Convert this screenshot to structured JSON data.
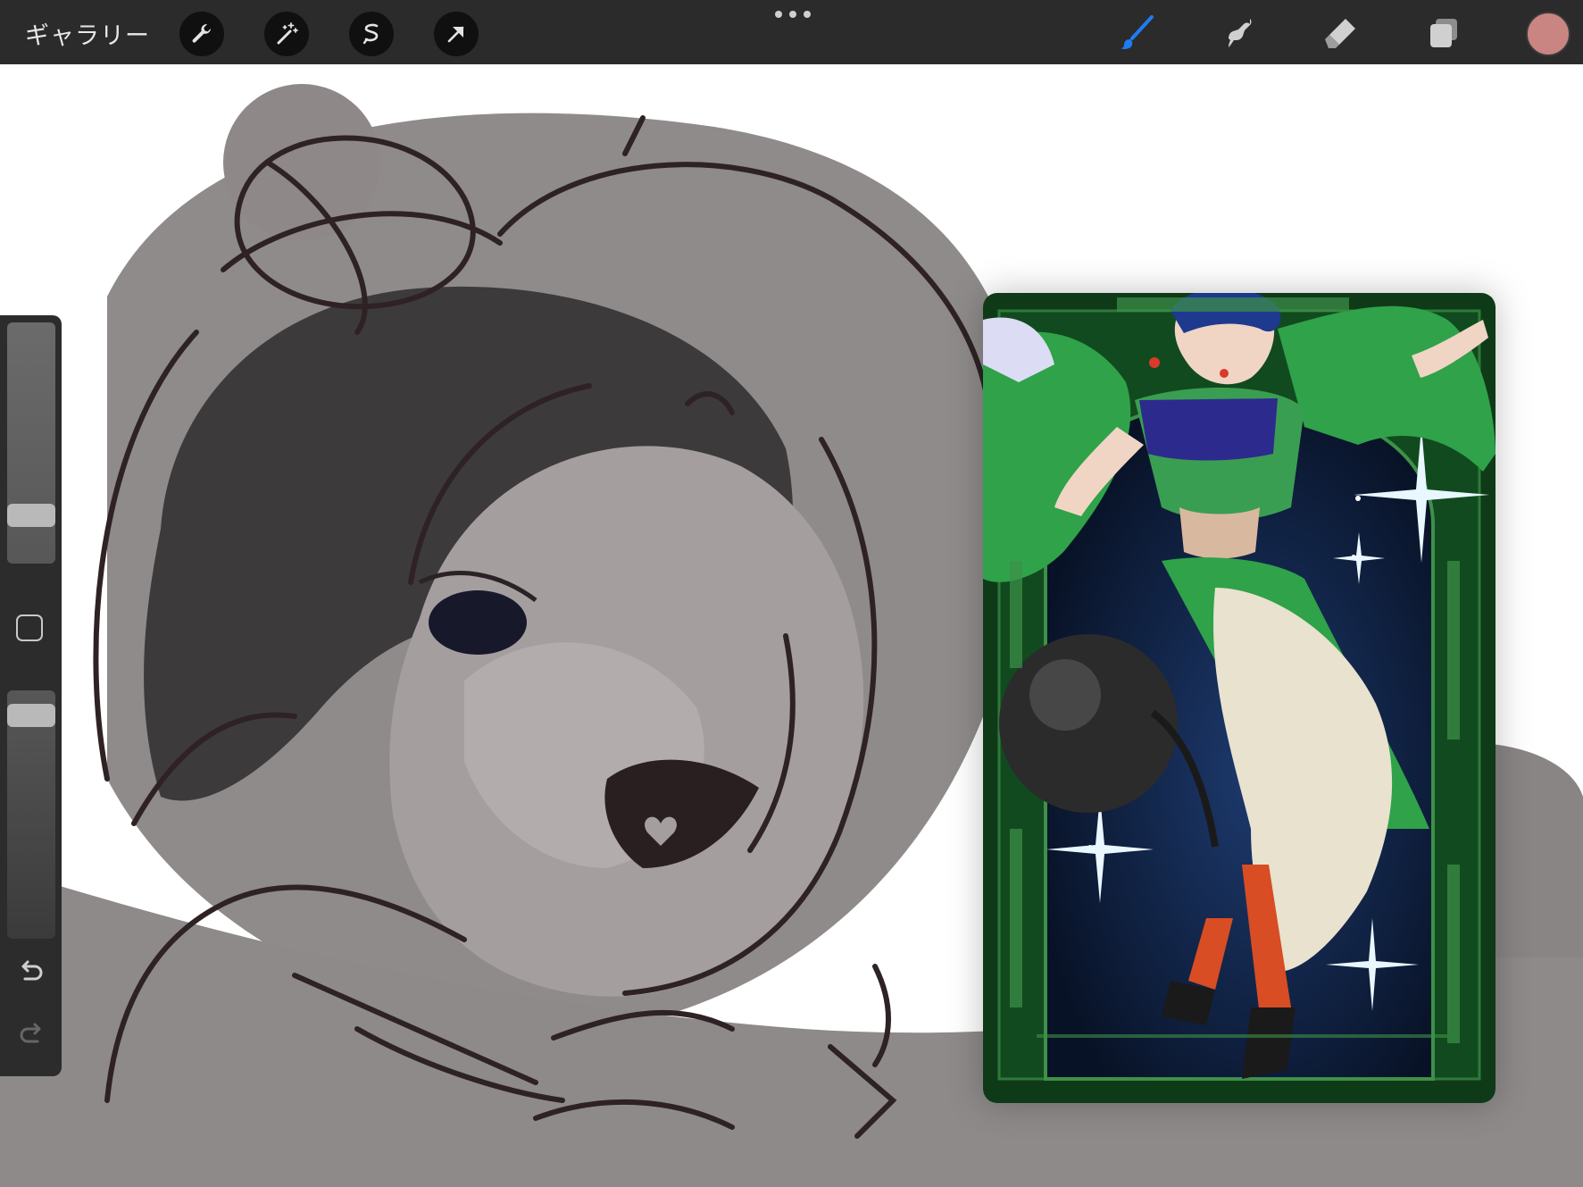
{
  "toolbar": {
    "gallery_label": "ギャラリー",
    "left_tools": [
      "wrench-icon",
      "magic-wand-icon",
      "selection-icon",
      "transform-arrow-icon"
    ],
    "right_tools": [
      "brush-icon",
      "smudge-icon",
      "eraser-icon",
      "layers-icon"
    ],
    "active_tool": "brush-icon",
    "current_color": "#c98582",
    "accent_color": "#1f7cf2"
  },
  "sidebar": {
    "brush_size_level": 0.17,
    "opacity_level": 0.94,
    "buttons": [
      "modify-square-icon",
      "undo-icon",
      "redo-icon"
    ]
  },
  "reference": {
    "palette": [
      "#1f6b2a",
      "#2e9e45",
      "#0b1a3a",
      "#e8e2cf",
      "#d84d24",
      "#1a1a1a"
    ]
  }
}
